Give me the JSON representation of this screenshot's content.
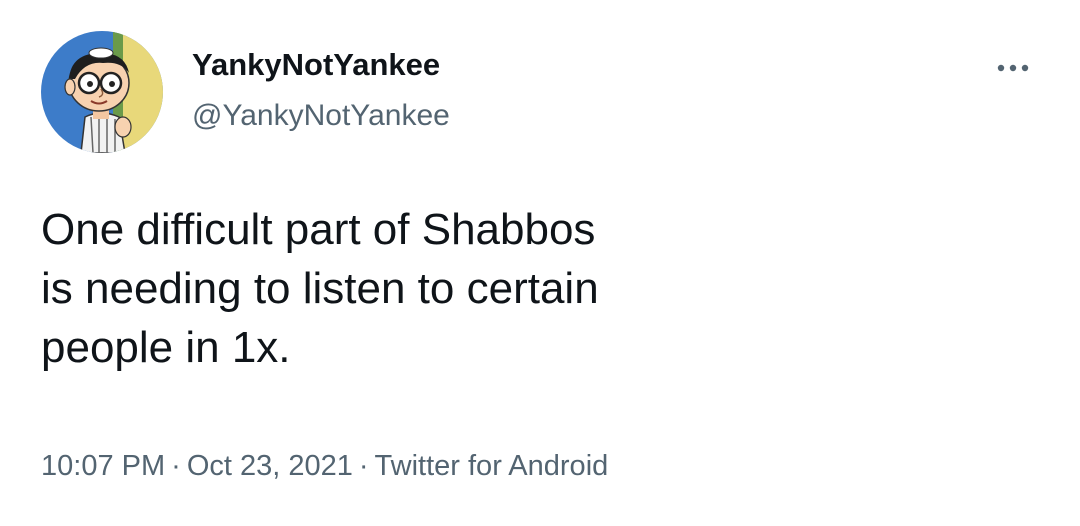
{
  "user": {
    "display_name": "YankyNotYankee",
    "handle": "@YankyNotYankee",
    "avatar_icon": "cartoon-boy-with-glasses-avatar"
  },
  "menu": {
    "icon": "more-horizontal-icon"
  },
  "tweet": {
    "text": "One difficult part of Shabbos\nis needing to listen to certain\npeople in 1x.",
    "time": "10:07 PM",
    "separator": "·",
    "date": "Oct 23, 2021",
    "source": "Twitter for Android"
  },
  "colors": {
    "text_primary": "#0f1419",
    "text_secondary": "#536471",
    "background": "#ffffff"
  }
}
